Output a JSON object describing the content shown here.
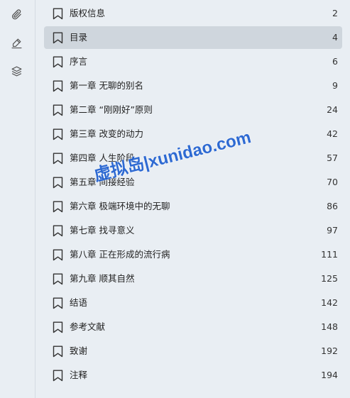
{
  "toolbar": {
    "icons": [
      "attachment-icon",
      "pen-icon",
      "layers-icon"
    ]
  },
  "toc": {
    "selected_index": 1,
    "items": [
      {
        "title": "版权信息",
        "page": "2"
      },
      {
        "title": "目录",
        "page": "4"
      },
      {
        "title": "序言",
        "page": "6"
      },
      {
        "title": "第一章 无聊的别名",
        "page": "9"
      },
      {
        "title": "第二章 “刚刚好”原则",
        "page": "24"
      },
      {
        "title": "第三章 改变的动力",
        "page": "42"
      },
      {
        "title": "第四章 人生阶段",
        "page": "57"
      },
      {
        "title": "第五章 间接经验",
        "page": "70"
      },
      {
        "title": "第六章 极端环境中的无聊",
        "page": "86"
      },
      {
        "title": "第七章 找寻意义",
        "page": "97"
      },
      {
        "title": "第八章 正在形成的流行病",
        "page": "111"
      },
      {
        "title": "第九章 顺其自然",
        "page": "125"
      },
      {
        "title": "结语",
        "page": "142"
      },
      {
        "title": "参考文献",
        "page": "148"
      },
      {
        "title": "致谢",
        "page": "192"
      },
      {
        "title": "注释",
        "page": "194"
      }
    ]
  },
  "watermark": {
    "text": "虚拟岛|xunidao.com",
    "color": "#1f5fd0"
  },
  "colors": {
    "background": "#e9eef3",
    "selected_row": "#cfd6dd",
    "text": "#222222",
    "icon": "#555555"
  }
}
